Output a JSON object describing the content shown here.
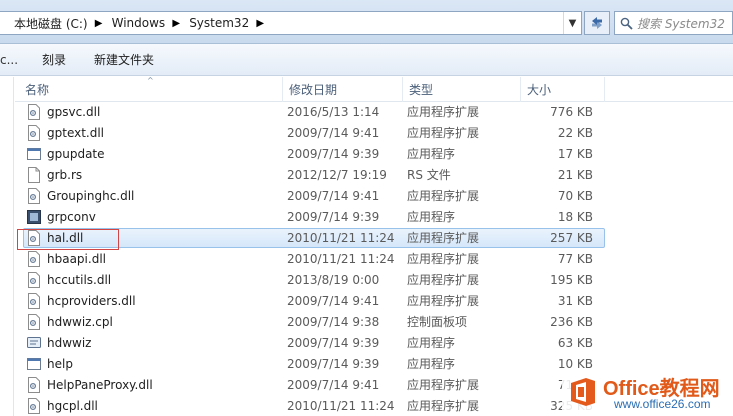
{
  "address": {
    "crumbs": [
      "本地磁盘 (C:)",
      "Windows",
      "System32"
    ],
    "search_placeholder": "搜索 System32"
  },
  "toolbar": {
    "left_fragment": "c...",
    "burn_label": "刻录",
    "new_folder_label": "新建文件夹"
  },
  "columns": {
    "name": "名称",
    "date": "修改日期",
    "type": "类型",
    "size": "大小"
  },
  "files": [
    {
      "name": "gpsvc.dll",
      "date": "2016/5/13 1:14",
      "type": "应用程序扩展",
      "size": "776 KB",
      "icon": "dll-icon"
    },
    {
      "name": "gptext.dll",
      "date": "2009/7/14 9:41",
      "type": "应用程序扩展",
      "size": "22 KB",
      "icon": "dll-icon"
    },
    {
      "name": "gpupdate",
      "date": "2009/7/14 9:39",
      "type": "应用程序",
      "size": "17 KB",
      "icon": "exe-icon"
    },
    {
      "name": "grb.rs",
      "date": "2012/12/7 19:19",
      "type": "RS 文件",
      "size": "21 KB",
      "icon": "file-icon"
    },
    {
      "name": "Groupinghc.dll",
      "date": "2009/7/14 9:41",
      "type": "应用程序扩展",
      "size": "70 KB",
      "icon": "dll-icon"
    },
    {
      "name": "grpconv",
      "date": "2009/7/14 9:39",
      "type": "应用程序",
      "size": "18 KB",
      "icon": "exe-icon"
    },
    {
      "name": "hal.dll",
      "date": "2010/11/21 11:24",
      "type": "应用程序扩展",
      "size": "257 KB",
      "icon": "dll-icon",
      "selected": true
    },
    {
      "name": "hbaapi.dll",
      "date": "2010/11/21 11:24",
      "type": "应用程序扩展",
      "size": "77 KB",
      "icon": "dll-icon"
    },
    {
      "name": "hccutils.dll",
      "date": "2013/8/19 0:00",
      "type": "应用程序扩展",
      "size": "195 KB",
      "icon": "dll-icon"
    },
    {
      "name": "hcproviders.dll",
      "date": "2009/7/14 9:41",
      "type": "应用程序扩展",
      "size": "31 KB",
      "icon": "dll-icon"
    },
    {
      "name": "hdwwiz.cpl",
      "date": "2009/7/14 9:38",
      "type": "控制面板项",
      "size": "236 KB",
      "icon": "cpl-icon"
    },
    {
      "name": "hdwwiz",
      "date": "2009/7/14 9:39",
      "type": "应用程序",
      "size": "63 KB",
      "icon": "exe-icon"
    },
    {
      "name": "help",
      "date": "2009/7/14 9:39",
      "type": "应用程序",
      "size": "10 KB",
      "icon": "exe-icon"
    },
    {
      "name": "HelpPaneProxy.dll",
      "date": "2009/7/14 9:41",
      "type": "应用程序扩展",
      "size": "71 KB",
      "icon": "dll-icon"
    },
    {
      "name": "hgcpl.dll",
      "date": "2010/11/21 11:24",
      "type": "应用程序扩展",
      "size": "325 KB",
      "icon": "dll-icon"
    }
  ],
  "watermark": {
    "name": "Office教程网",
    "url": "www.office26.com"
  },
  "colors": {
    "selection": "#d5e7fa",
    "selection_border": "#99c2ea",
    "highlight_box": "#d24545",
    "watermark_orange": "#e15a1a",
    "watermark_blue": "#2a6db3"
  }
}
